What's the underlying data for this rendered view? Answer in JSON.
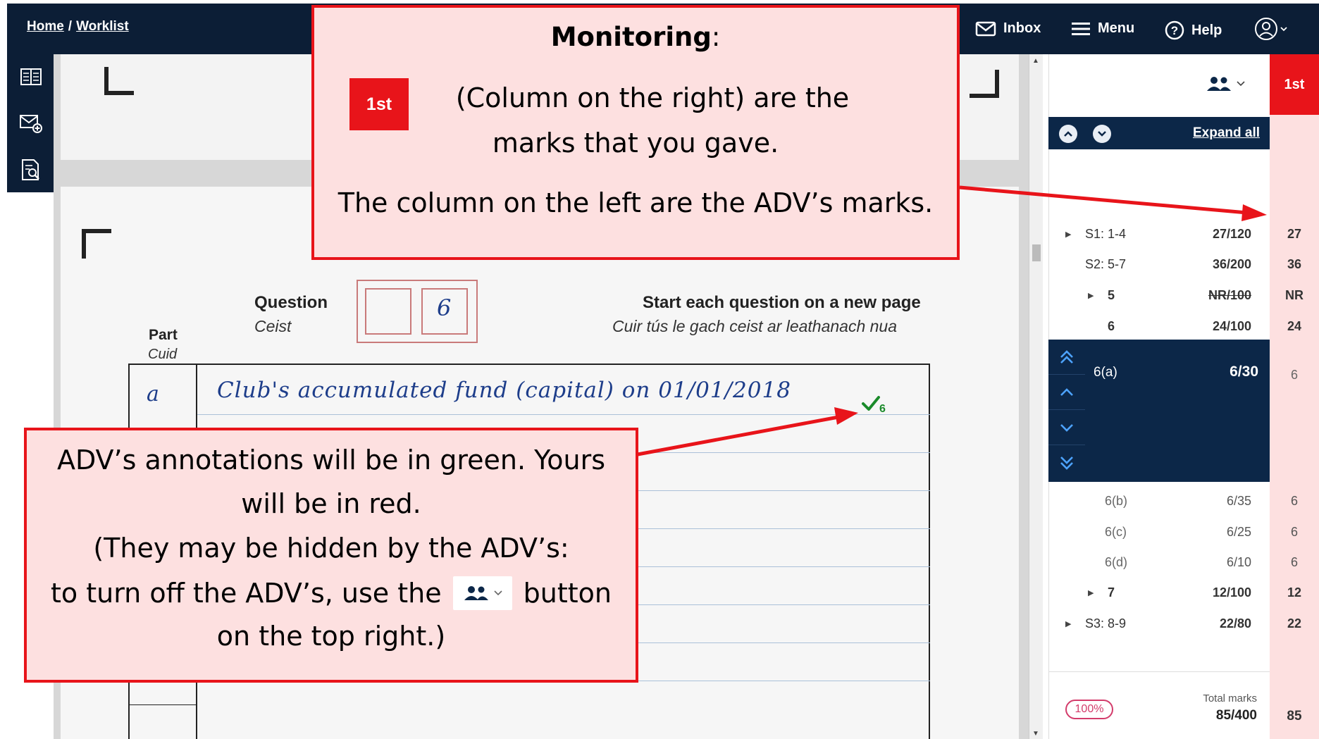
{
  "header": {
    "breadcrumb": {
      "home": "Home",
      "separator": "/",
      "worklist": "Worklist"
    },
    "inbox_label": "Inbox",
    "menu_label": "Menu",
    "help_label": "Help"
  },
  "document": {
    "question_label": "Question",
    "question_label_irish": "Ceist",
    "question_number": "6",
    "part_label": "Part",
    "part_label_irish": "Cuid",
    "instruction": "Start each question on a new page",
    "instruction_irish": "Cuir tús le gach ceist ar leathanach nua",
    "part_value": "a",
    "handwriting": "Club's accumulated fund (capital) on 01/01/2018",
    "annotation_mark": "6",
    "annotation_color": "#1a8a2a"
  },
  "marks_panel": {
    "first_column_label": "1st",
    "expand_all_label": "Expand all",
    "rows": [
      {
        "label": "S1: 1-4",
        "mark": "27/120",
        "first": "27"
      },
      {
        "label": "S2: 5-7",
        "mark": "36/200",
        "first": "36"
      },
      {
        "label": "5",
        "mark": "NR/100",
        "first": "NR"
      },
      {
        "label": "6",
        "mark": "24/100",
        "first": "24"
      },
      {
        "label": "6(a)",
        "mark": "6/30",
        "first": "6"
      },
      {
        "label": "6(b)",
        "mark": "6/35",
        "first": "6"
      },
      {
        "label": "6(c)",
        "mark": "6/25",
        "first": "6"
      },
      {
        "label": "6(d)",
        "mark": "6/10",
        "first": "6"
      },
      {
        "label": "7",
        "mark": "12/100",
        "first": "12"
      },
      {
        "label": "S3: 8-9",
        "mark": "22/80",
        "first": "22"
      }
    ],
    "progress_badge": "100%",
    "total_label": "Total marks",
    "total_mark": "85/400",
    "total_first": "85"
  },
  "callout_top": {
    "title": "Monitoring",
    "title_suffix": ":",
    "tag": "1st",
    "line1": "(Column on the right) are the",
    "line2": "marks that you gave.",
    "line3": "The column on the left are the ADV’s marks."
  },
  "callout_bottom": {
    "line1": "ADV’s annotations will be in green.  Yours",
    "line2": "will be in red.",
    "line3": "(They may be hidden by the ADV’s:",
    "line4_before": "to turn off the ADV’s, use the",
    "line4_after": "button",
    "line5": "on the top right.)"
  },
  "colors": {
    "navy": "#0c1e36",
    "panel_navy": "#0c2748",
    "accent_red": "#e8141a",
    "callout_bg": "#fde0e0",
    "adv_green": "#1a8a2a"
  },
  "icons": [
    "book-icon",
    "mail-plus-icon",
    "document-search-icon",
    "envelope-icon",
    "hamburger-icon",
    "help-circle-icon",
    "user-circle-icon",
    "people-icon",
    "chevron-up-icon",
    "chevron-down-icon",
    "double-chevron-up-icon",
    "double-chevron-down-icon",
    "checkmark-icon"
  ]
}
